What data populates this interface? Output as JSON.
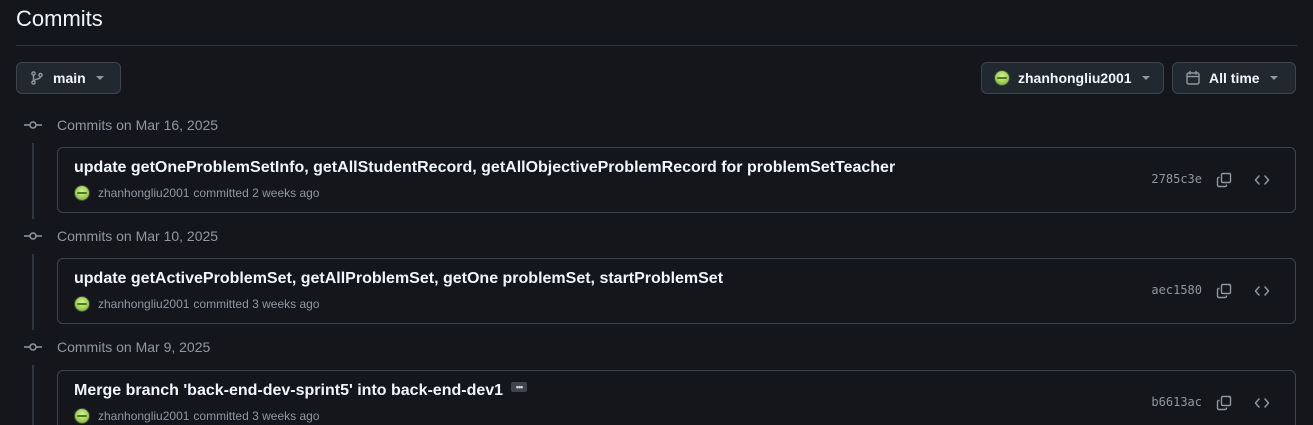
{
  "header": {
    "title": "Commits"
  },
  "filters": {
    "branch": "main",
    "author": "zhanhongliu2001",
    "time": "All time"
  },
  "groups": [
    {
      "date_label": "Commits on Mar 16, 2025",
      "commit": {
        "message": "update getOneProblemSetInfo, getAllStudentRecord, getAllObjectiveProblemRecord for problemSetTeacher",
        "author": "zhanhongliu2001",
        "committed_text": "committed 2 weeks ago",
        "sha": "2785c3e"
      }
    },
    {
      "date_label": "Commits on Mar 10, 2025",
      "commit": {
        "message": "update getActiveProblemSet, getAllProblemSet, getOne problemSet, startProblemSet",
        "author": "zhanhongliu2001",
        "committed_text": "committed 3 weeks ago",
        "sha": "aec1580"
      }
    },
    {
      "date_label": "Commits on Mar 9, 2025",
      "commit": {
        "message": "Merge branch 'back-end-dev-sprint5' into back-end-dev1",
        "author": "zhanhongliu2001",
        "committed_text": "committed 3 weeks ago",
        "sha": "b6613ac",
        "has_ellipsis": true
      }
    }
  ],
  "icons": {
    "branch": "git-branch-icon",
    "calendar": "calendar-icon",
    "commit_node": "git-commit-icon",
    "copy": "copy-icon",
    "browse_code": "code-icon",
    "ellipsis": "ellipsis-icon"
  },
  "colors": {
    "background": "#14161b",
    "border": "#3d444d",
    "text_primary": "#f0f6fc",
    "text_muted": "#9198a1"
  }
}
